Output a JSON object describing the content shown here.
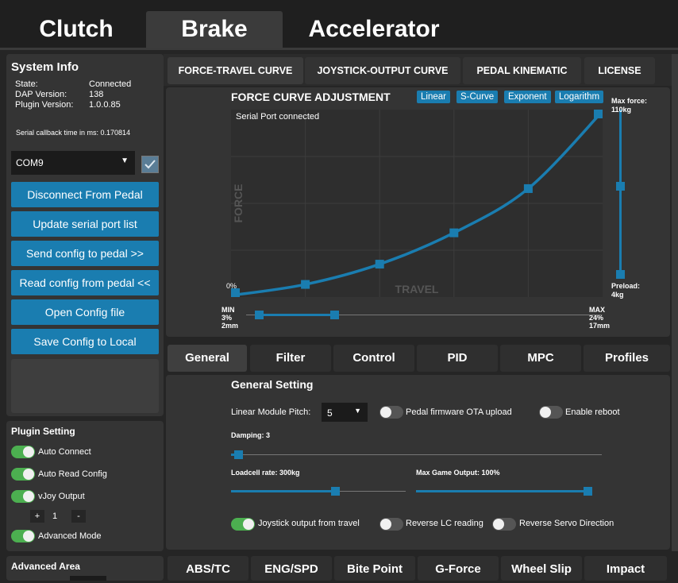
{
  "top_tabs": [
    {
      "label": "Clutch",
      "active": false
    },
    {
      "label": "Brake",
      "active": true
    },
    {
      "label": "Accelerator",
      "active": false
    }
  ],
  "system_info": {
    "title": "System Info",
    "state_label": "State:",
    "state_value": "Connected",
    "dap_label": "DAP Version:",
    "dap_value": "138",
    "plugin_label": "Plugin Version:",
    "plugin_value": "1.0.0.85",
    "serial_callback": "Serial callback time in ms: 0.170814",
    "com_port": "COM9",
    "buttons": [
      "Disconnect From Pedal",
      "Update serial port list",
      "Send config to pedal >>",
      "Read config from pedal <<",
      "Open Config file",
      "Save Config to Local"
    ]
  },
  "plugin_setting": {
    "title": "Plugin Setting",
    "auto_connect": "Auto Connect",
    "auto_read": "Auto Read Config",
    "vjoy": "vJoy Output",
    "plus": "+",
    "count": "1",
    "minus": "-",
    "advanced": "Advanced Mode"
  },
  "advanced_area": {
    "title": "Advanced Area"
  },
  "upper_tabs": [
    "FORCE-TRAVEL CURVE",
    "JOYSTICK-OUTPUT CURVE",
    "PEDAL KINEMATIC",
    "LICENSE"
  ],
  "curve": {
    "title": "FORCE CURVE ADJUSTMENT",
    "presets": [
      "Linear",
      "S-Curve",
      "Exponent",
      "Logarithm"
    ],
    "status": "Serial Port connected",
    "force_label": "FORCE",
    "travel_label": "TRAVEL",
    "zero_label": "0%",
    "max_force_label": "Max force:",
    "max_force_value": "110kg",
    "preload_label": "Preload:",
    "preload_value": "4kg",
    "min_label": "MIN",
    "min_pct": "3%",
    "min_mm": "2mm",
    "max_label": "MAX",
    "max_pct": "24%",
    "max_mm": "17mm",
    "accent": "#1a7db0"
  },
  "chart_data": {
    "type": "line",
    "xlabel": "TRAVEL",
    "ylabel": "FORCE",
    "x": [
      0,
      20,
      40,
      60,
      80,
      100
    ],
    "y": [
      0,
      6,
      17,
      34,
      58,
      100
    ],
    "xlim": [
      0,
      100
    ],
    "ylim": [
      0,
      100
    ],
    "grid": true
  },
  "middle_tabs": [
    "General",
    "Filter",
    "Control",
    "PID",
    "MPC",
    "Profiles"
  ],
  "general": {
    "title": "General Setting",
    "pitch_label": "Linear Module Pitch:",
    "pitch_value": "5",
    "ota_label": "Pedal firmware OTA upload",
    "reboot_label": "Enable reboot",
    "damping_label": "Damping: 3",
    "loadcell_label": "Loadcell rate: 300kg",
    "max_game_label": "Max Game Output: 100%",
    "joystick_label": "Joystick output from travel",
    "reverse_lc_label": "Reverse LC reading",
    "reverse_servo_label": "Reverse Servo Direction"
  },
  "bottom_tabs": [
    "ABS/TC",
    "ENG/SPD",
    "Bite Point",
    "G-Force",
    "Wheel Slip",
    "Impact"
  ]
}
